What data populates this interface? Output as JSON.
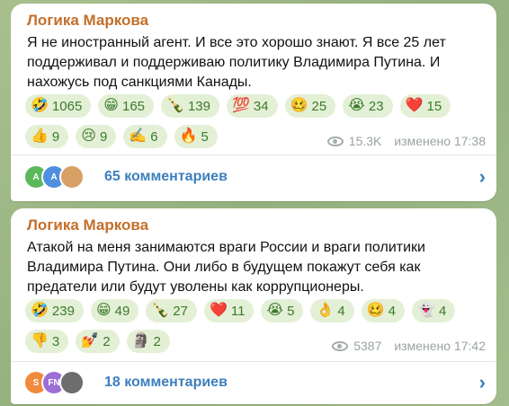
{
  "posts": [
    {
      "author": "Логика Маркова",
      "text": "Я не иностранный агент. И все это хорошо знают. Я все 25 лет поддерживал и поддерживаю политику Владимира Путина. И нахожусь под санкциями Канады.",
      "reaction_rows": [
        [
          {
            "emoji": "🤣",
            "count": "1065"
          },
          {
            "emoji": "😁",
            "count": "165"
          },
          {
            "emoji": "🍾",
            "count": "139"
          },
          {
            "emoji": "💯",
            "count": "34"
          },
          {
            "emoji": "🥴",
            "count": "25"
          },
          {
            "emoji": "😭",
            "count": "23"
          },
          {
            "emoji": "❤️",
            "count": "15"
          }
        ],
        [
          {
            "emoji": "👍",
            "count": "9"
          },
          {
            "emoji": "😢",
            "count": "9"
          },
          {
            "emoji": "✍️",
            "count": "6"
          },
          {
            "emoji": "🔥",
            "count": "5"
          }
        ]
      ],
      "views": "15.3K",
      "edited": "изменено 17:38",
      "comments_label": "65 комментариев",
      "avatars": [
        {
          "initials": "A",
          "color": "#5cb85c"
        },
        {
          "initials": "A",
          "color": "#4f8fe0"
        },
        {
          "initials": "",
          "color": "#d9a066"
        }
      ]
    },
    {
      "author": "Логика Маркова",
      "text": "Атакой на меня занимаются враги России и враги политики Владимира Путина. Они либо в будущем покажут себя как предатели или будут уволены как коррупционеры.",
      "reaction_rows": [
        [
          {
            "emoji": "🤣",
            "count": "239"
          },
          {
            "emoji": "😁",
            "count": "49"
          },
          {
            "emoji": "🍾",
            "count": "27"
          },
          {
            "emoji": "❤️",
            "count": "11"
          },
          {
            "emoji": "😭",
            "count": "5"
          },
          {
            "emoji": "👌",
            "count": "4"
          },
          {
            "emoji": "🥴",
            "count": "4"
          },
          {
            "emoji": "👻",
            "count": "4"
          }
        ],
        [
          {
            "emoji": "👎",
            "count": "3"
          },
          {
            "emoji": "💅",
            "count": "2"
          },
          {
            "emoji": "🗿",
            "count": "2"
          }
        ]
      ],
      "views": "5387",
      "edited": "изменено 17:42",
      "comments_label": "18 комментариев",
      "avatars": [
        {
          "initials": "S",
          "color": "#f08a3c"
        },
        {
          "initials": "FN",
          "color": "#9b6fd6"
        },
        {
          "initials": "",
          "color": "#6d6d6d"
        }
      ]
    }
  ]
}
